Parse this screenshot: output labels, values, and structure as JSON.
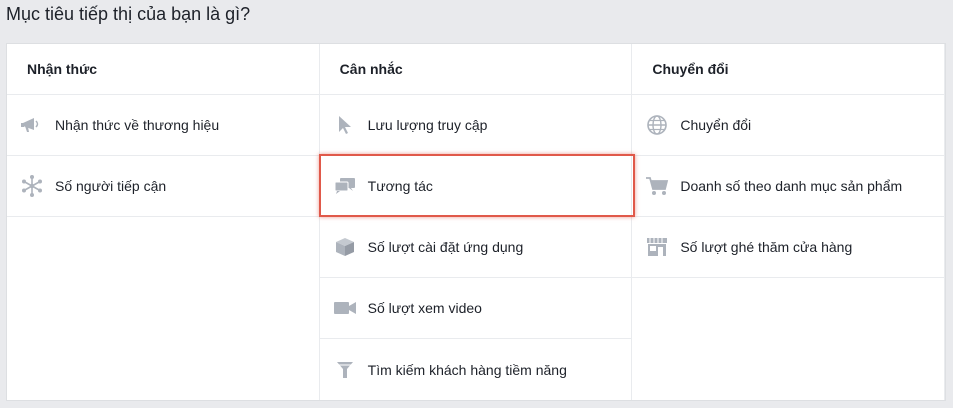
{
  "page": {
    "title": "Mục tiêu tiếp thị của bạn là gì?"
  },
  "columns": [
    {
      "header": "Nhận thức",
      "items": [
        {
          "label": "Nhận thức về thương hiệu",
          "icon": "megaphone-icon"
        },
        {
          "label": "Số người tiếp cận",
          "icon": "reach-burst-icon"
        }
      ]
    },
    {
      "header": "Cân nhắc",
      "items": [
        {
          "label": "Lưu lượng truy cập",
          "icon": "cursor-icon"
        },
        {
          "label": "Tương tác",
          "icon": "chat-bubbles-icon",
          "highlighted": true
        },
        {
          "label": "Số lượt cài đặt ứng dụng",
          "icon": "box-icon"
        },
        {
          "label": "Số lượt xem video",
          "icon": "video-camera-icon"
        },
        {
          "label": "Tìm kiếm khách hàng tiềm năng",
          "icon": "funnel-icon"
        }
      ]
    },
    {
      "header": "Chuyển đổi",
      "items": [
        {
          "label": "Chuyển đổi",
          "icon": "globe-icon"
        },
        {
          "label": "Doanh số theo danh mục sản phẩm",
          "icon": "shopping-cart-icon"
        },
        {
          "label": "Số lượt ghé thăm cửa hàng",
          "icon": "storefront-icon"
        }
      ]
    }
  ],
  "colors": {
    "background": "#e9eaed",
    "panel": "#ffffff",
    "divider": "#e9ebee",
    "icon": "#adb3bc",
    "highlight": "#e0594a"
  }
}
